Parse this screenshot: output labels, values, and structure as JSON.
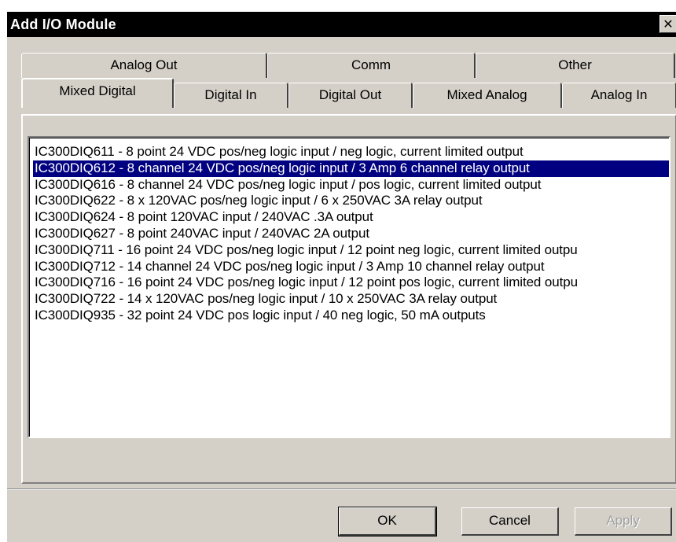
{
  "window": {
    "title": "Add I/O Module",
    "close_glyph": "✕"
  },
  "tabs": {
    "back_row": [
      {
        "label": "Analog Out"
      },
      {
        "label": "Comm"
      },
      {
        "label": "Other"
      }
    ],
    "front_row": [
      {
        "label": "Mixed Digital"
      },
      {
        "label": "Digital In"
      },
      {
        "label": "Digital Out"
      },
      {
        "label": "Mixed Analog"
      },
      {
        "label": "Analog In"
      }
    ],
    "selected": "Mixed Digital"
  },
  "modules": [
    {
      "text": "IC300DIQ611  -  8 point 24 VDC pos/neg logic input / neg logic, current limited output"
    },
    {
      "text": "IC300DIQ612  -  8 channel 24 VDC pos/neg logic input / 3 Amp 6 channel relay output"
    },
    {
      "text": "IC300DIQ616  -  8 channel 24 VDC pos/neg logic input / pos logic, current limited output"
    },
    {
      "text": "IC300DIQ622  -  8 x 120VAC pos/neg logic input / 6 x 250VAC 3A relay output"
    },
    {
      "text": "IC300DIQ624  -  8 point 120VAC input / 240VAC .3A output"
    },
    {
      "text": "IC300DIQ627  -  8 point 240VAC input / 240VAC 2A output"
    },
    {
      "text": "IC300DIQ711  -  16 point 24 VDC pos/neg logic input / 12 point neg logic, current limited outpu"
    },
    {
      "text": "IC300DIQ712  -  14 channel 24 VDC pos/neg logic input / 3 Amp 10 channel relay output"
    },
    {
      "text": "IC300DIQ716  -  16 point 24 VDC pos/neg logic input / 12 point pos logic, current limited outpu"
    },
    {
      "text": "IC300DIQ722  -  14 x 120VAC pos/neg logic input / 10 x 250VAC 3A relay output"
    },
    {
      "text": "IC300DIQ935  -  32 point 24 VDC pos logic input / 40 neg logic, 50 mA outputs"
    }
  ],
  "selected_module": "IC300DIQ612",
  "buttons": {
    "ok": "OK",
    "cancel": "Cancel",
    "apply": "Apply"
  },
  "colors": {
    "dialog_face": "#d4d0c8",
    "titlebar": "#000000",
    "selection": "#000080"
  }
}
